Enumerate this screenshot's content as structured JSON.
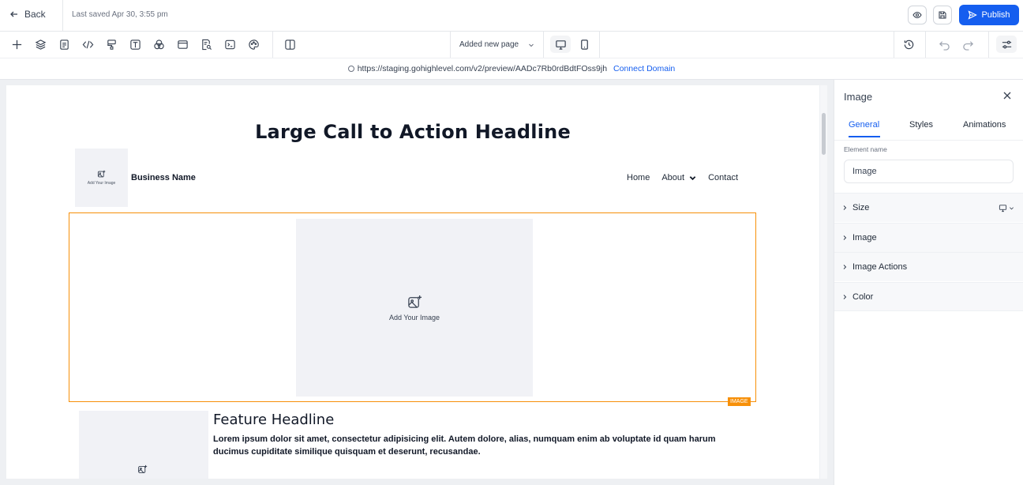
{
  "topbar": {
    "back_label": "Back",
    "last_saved": "Last saved Apr 30, 3:55 pm",
    "publish_label": "Publish"
  },
  "toolbar": {
    "page_select": "Added new page"
  },
  "urlbar": {
    "url": "https://staging.gohighlevel.com/v2/preview/AADc7Rb0rdBdtFOss9jh",
    "connect_domain": "Connect Domain"
  },
  "canvas": {
    "cta_headline": "Large Call to Action Headline",
    "logo_label": "Add Your Image",
    "business_name": "Business Name",
    "nav_links": [
      "Home",
      "About",
      "Contact"
    ],
    "image_placeholder_label": "Add Your Image",
    "image_tag": "IMAGE",
    "feature_headline": "Feature Headline",
    "feature_body": "Lorem ipsum dolor sit amet, consectetur adipisicing elit. Autem dolore, alias, numquam enim ab voluptate id quam harum ducimus cupiditate similique quisquam et deserunt, recusandae."
  },
  "panel": {
    "title": "Image",
    "tabs": [
      "General",
      "Styles",
      "Animations"
    ],
    "active_tab": "General",
    "element_name_label": "Element name",
    "element_name_value": "Image",
    "sections": [
      "Size",
      "Image",
      "Image Actions",
      "Color"
    ]
  },
  "colors": {
    "accent": "#155eef",
    "selection": "#f79009",
    "canvas_bg": "#eef0f3",
    "placeholder_bg": "#f1f2f6"
  }
}
